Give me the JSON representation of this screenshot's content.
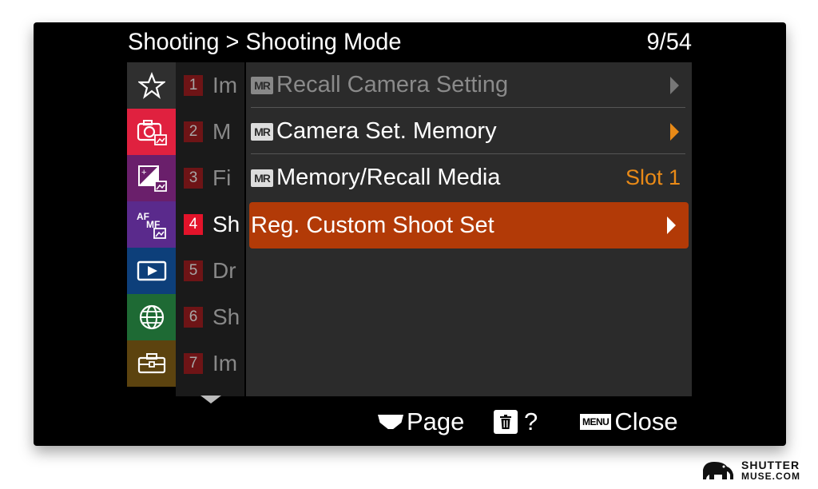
{
  "header": {
    "crumb_root": "Shooting",
    "separator": ">",
    "crumb_current": "Shooting Mode",
    "page_indicator": "9/54"
  },
  "tabs": [
    {
      "icon": "star-icon",
      "color": "#2f2f2f"
    },
    {
      "icon": "camera-icon",
      "color": "#e0213f"
    },
    {
      "icon": "exposure-icon",
      "color": "#6a1f6b"
    },
    {
      "icon": "af-mf-icon",
      "color": "#5a2a8c"
    },
    {
      "icon": "playback-icon",
      "color": "#0d3f7a"
    },
    {
      "icon": "globe-icon",
      "color": "#1e6a34"
    },
    {
      "icon": "toolbox-icon",
      "color": "#5c430f"
    }
  ],
  "groups": [
    {
      "num": "1",
      "label": "Im",
      "active": false
    },
    {
      "num": "2",
      "label": "M",
      "active": false
    },
    {
      "num": "3",
      "label": "Fi",
      "active": false
    },
    {
      "num": "4",
      "label": "Sh",
      "active": true
    },
    {
      "num": "5",
      "label": "Dr",
      "active": false
    },
    {
      "num": "6",
      "label": "Sh",
      "active": false
    },
    {
      "num": "7",
      "label": "Im",
      "active": false
    }
  ],
  "menu": {
    "mr_badge": "MR",
    "items": [
      {
        "label": "Recall Camera Setting",
        "value": "",
        "state": "disabled"
      },
      {
        "label": "Camera Set. Memory",
        "value": "",
        "state": "normal"
      },
      {
        "label": "Memory/Recall Media",
        "value": "Slot 1",
        "state": "normal"
      },
      {
        "label": "Reg. Custom Shoot Set",
        "value": "",
        "state": "selected"
      }
    ]
  },
  "footer": {
    "page_label": "Page",
    "help_label": "?",
    "menu_key": "MENU",
    "close_label": "Close"
  },
  "watermark": {
    "line1": "SHUTTER",
    "line2": "MUSE.COM"
  },
  "colors": {
    "selected_row": "#b23a07",
    "accent_orange": "#e98a17",
    "active_number": "#e3132a"
  }
}
